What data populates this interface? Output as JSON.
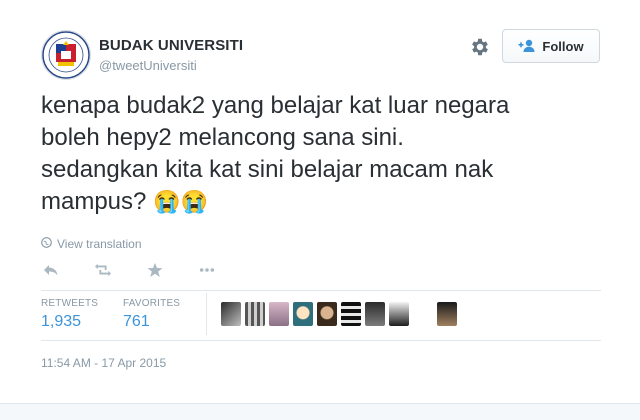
{
  "user": {
    "name": "BUDAK UNIVERSITI",
    "handle": "@tweetUniversiti"
  },
  "follow_button": {
    "label": "Follow"
  },
  "tweet": {
    "text_line1": "kenapa budak2 yang belajar kat luar negara",
    "text_line2": "boleh hepy2 melancong sana sini.",
    "text_line3": "sedangkan kita kat sini belajar macam nak",
    "text_line4": "mampus?",
    "emoji": "😭😭",
    "translation_link": "View translation"
  },
  "stats": {
    "retweets_label": "RETWEETS",
    "retweets_value": "1,935",
    "favorites_label": "FAVORITES",
    "favorites_value": "761"
  },
  "timestamp": "11:54 AM - 17 Apr 2015",
  "icons": [
    "gear-icon",
    "add-user-icon",
    "globe-icon",
    "reply-icon",
    "retweet-icon",
    "favorite-star-icon",
    "more-icon"
  ],
  "colors": {
    "link": "#3b94d9",
    "muted": "#8899a6",
    "text": "#292f33"
  }
}
